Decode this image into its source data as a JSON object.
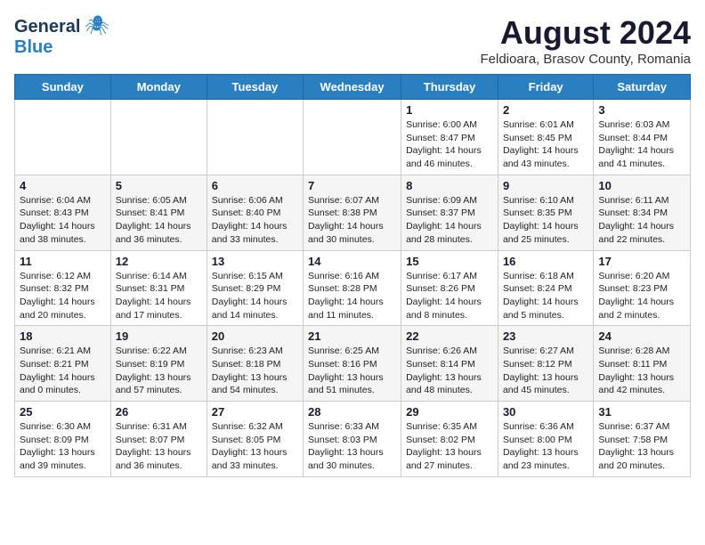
{
  "header": {
    "logo_general": "General",
    "logo_blue": "Blue",
    "month_year": "August 2024",
    "location": "Feldioara, Brasov County, Romania"
  },
  "days_of_week": [
    "Sunday",
    "Monday",
    "Tuesday",
    "Wednesday",
    "Thursday",
    "Friday",
    "Saturday"
  ],
  "weeks": [
    [
      {
        "day": "",
        "info": ""
      },
      {
        "day": "",
        "info": ""
      },
      {
        "day": "",
        "info": ""
      },
      {
        "day": "",
        "info": ""
      },
      {
        "day": "1",
        "info": "Sunrise: 6:00 AM\nSunset: 8:47 PM\nDaylight: 14 hours\nand 46 minutes."
      },
      {
        "day": "2",
        "info": "Sunrise: 6:01 AM\nSunset: 8:45 PM\nDaylight: 14 hours\nand 43 minutes."
      },
      {
        "day": "3",
        "info": "Sunrise: 6:03 AM\nSunset: 8:44 PM\nDaylight: 14 hours\nand 41 minutes."
      }
    ],
    [
      {
        "day": "4",
        "info": "Sunrise: 6:04 AM\nSunset: 8:43 PM\nDaylight: 14 hours\nand 38 minutes."
      },
      {
        "day": "5",
        "info": "Sunrise: 6:05 AM\nSunset: 8:41 PM\nDaylight: 14 hours\nand 36 minutes."
      },
      {
        "day": "6",
        "info": "Sunrise: 6:06 AM\nSunset: 8:40 PM\nDaylight: 14 hours\nand 33 minutes."
      },
      {
        "day": "7",
        "info": "Sunrise: 6:07 AM\nSunset: 8:38 PM\nDaylight: 14 hours\nand 30 minutes."
      },
      {
        "day": "8",
        "info": "Sunrise: 6:09 AM\nSunset: 8:37 PM\nDaylight: 14 hours\nand 28 minutes."
      },
      {
        "day": "9",
        "info": "Sunrise: 6:10 AM\nSunset: 8:35 PM\nDaylight: 14 hours\nand 25 minutes."
      },
      {
        "day": "10",
        "info": "Sunrise: 6:11 AM\nSunset: 8:34 PM\nDaylight: 14 hours\nand 22 minutes."
      }
    ],
    [
      {
        "day": "11",
        "info": "Sunrise: 6:12 AM\nSunset: 8:32 PM\nDaylight: 14 hours\nand 20 minutes."
      },
      {
        "day": "12",
        "info": "Sunrise: 6:14 AM\nSunset: 8:31 PM\nDaylight: 14 hours\nand 17 minutes."
      },
      {
        "day": "13",
        "info": "Sunrise: 6:15 AM\nSunset: 8:29 PM\nDaylight: 14 hours\nand 14 minutes."
      },
      {
        "day": "14",
        "info": "Sunrise: 6:16 AM\nSunset: 8:28 PM\nDaylight: 14 hours\nand 11 minutes."
      },
      {
        "day": "15",
        "info": "Sunrise: 6:17 AM\nSunset: 8:26 PM\nDaylight: 14 hours\nand 8 minutes."
      },
      {
        "day": "16",
        "info": "Sunrise: 6:18 AM\nSunset: 8:24 PM\nDaylight: 14 hours\nand 5 minutes."
      },
      {
        "day": "17",
        "info": "Sunrise: 6:20 AM\nSunset: 8:23 PM\nDaylight: 14 hours\nand 2 minutes."
      }
    ],
    [
      {
        "day": "18",
        "info": "Sunrise: 6:21 AM\nSunset: 8:21 PM\nDaylight: 14 hours\nand 0 minutes."
      },
      {
        "day": "19",
        "info": "Sunrise: 6:22 AM\nSunset: 8:19 PM\nDaylight: 13 hours\nand 57 minutes."
      },
      {
        "day": "20",
        "info": "Sunrise: 6:23 AM\nSunset: 8:18 PM\nDaylight: 13 hours\nand 54 minutes."
      },
      {
        "day": "21",
        "info": "Sunrise: 6:25 AM\nSunset: 8:16 PM\nDaylight: 13 hours\nand 51 minutes."
      },
      {
        "day": "22",
        "info": "Sunrise: 6:26 AM\nSunset: 8:14 PM\nDaylight: 13 hours\nand 48 minutes."
      },
      {
        "day": "23",
        "info": "Sunrise: 6:27 AM\nSunset: 8:12 PM\nDaylight: 13 hours\nand 45 minutes."
      },
      {
        "day": "24",
        "info": "Sunrise: 6:28 AM\nSunset: 8:11 PM\nDaylight: 13 hours\nand 42 minutes."
      }
    ],
    [
      {
        "day": "25",
        "info": "Sunrise: 6:30 AM\nSunset: 8:09 PM\nDaylight: 13 hours\nand 39 minutes."
      },
      {
        "day": "26",
        "info": "Sunrise: 6:31 AM\nSunset: 8:07 PM\nDaylight: 13 hours\nand 36 minutes."
      },
      {
        "day": "27",
        "info": "Sunrise: 6:32 AM\nSunset: 8:05 PM\nDaylight: 13 hours\nand 33 minutes."
      },
      {
        "day": "28",
        "info": "Sunrise: 6:33 AM\nSunset: 8:03 PM\nDaylight: 13 hours\nand 30 minutes."
      },
      {
        "day": "29",
        "info": "Sunrise: 6:35 AM\nSunset: 8:02 PM\nDaylight: 13 hours\nand 27 minutes."
      },
      {
        "day": "30",
        "info": "Sunrise: 6:36 AM\nSunset: 8:00 PM\nDaylight: 13 hours\nand 23 minutes."
      },
      {
        "day": "31",
        "info": "Sunrise: 6:37 AM\nSunset: 7:58 PM\nDaylight: 13 hours\nand 20 minutes."
      }
    ]
  ],
  "row_styles": [
    "white",
    "gray",
    "white",
    "gray",
    "white"
  ]
}
